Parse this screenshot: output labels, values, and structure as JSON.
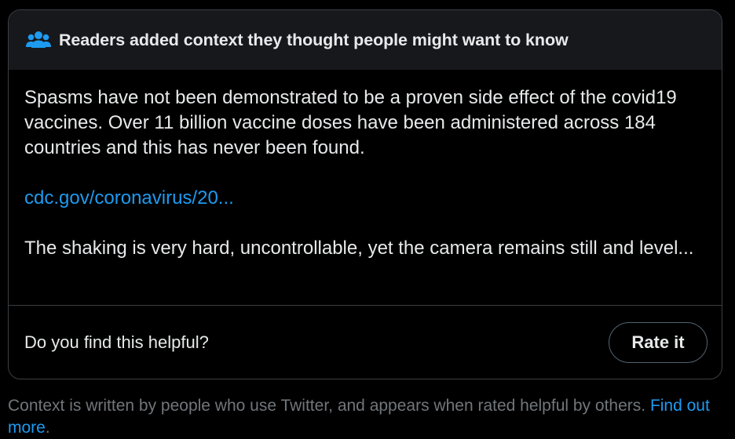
{
  "note": {
    "header_title": "Readers added context they thought people might want to know",
    "header_icon": "people-icon",
    "body_text": "Spasms have not been demonstrated to be a proven side effect of the covid19 vaccines. Over 11 billion vaccine doses have been administered across 184 countries and this has never been found.",
    "source_link": "cdc.gov/coronavirus/20...",
    "excerpt_text": "The shaking is very hard, uncontrollable, yet the camera remains still and level...",
    "helpful_question": "Do you find this helpful?",
    "rate_button_label": "Rate it"
  },
  "disclaimer": {
    "text": "Context is written by people who use Twitter, and appears when rated helpful by others.",
    "link_label": "Find out more",
    "trailing": "."
  },
  "colors": {
    "background": "#000000",
    "header_background": "#16181c",
    "text": "#e7e9ea",
    "link": "#1d9bf0",
    "muted": "#71767b",
    "border": "#3b3f44",
    "icon": "#1d9bf0"
  }
}
